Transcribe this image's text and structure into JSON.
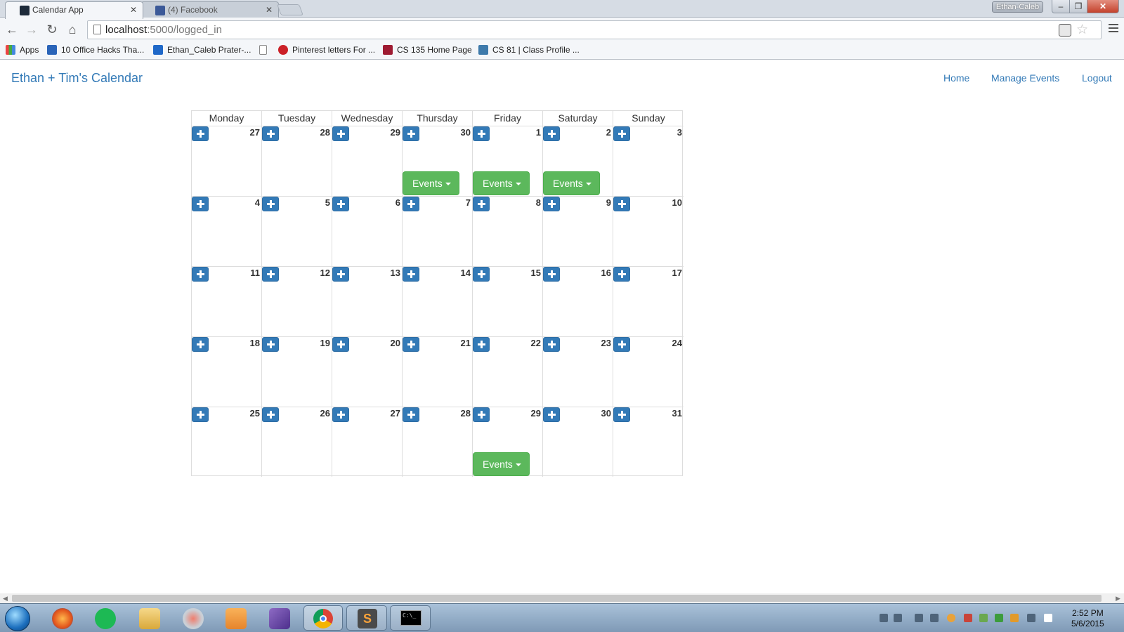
{
  "browser": {
    "tabs": [
      {
        "label": "Calendar App",
        "active": true
      },
      {
        "label": "(4) Facebook",
        "active": false
      }
    ],
    "user_badge": "Ethan-Caleb",
    "url_host": "localhost",
    "url_rest": ":5000/logged_in",
    "bookmarks": [
      {
        "label": "Apps",
        "icon": "apps-grid-icon"
      },
      {
        "label": "10 Office Hacks Tha...",
        "icon": "office-icon"
      },
      {
        "label": "Ethan_Caleb Prater-...",
        "icon": "outlook-icon"
      },
      {
        "label": "",
        "icon": "blank-page-icon"
      },
      {
        "label": "Pinterest letters For ...",
        "icon": "pinterest-icon"
      },
      {
        "label": "CS 135 Home Page",
        "icon": "cs135-icon"
      },
      {
        "label": "CS 81 | Class Profile ...",
        "icon": "piazza-icon"
      }
    ]
  },
  "app": {
    "brand": "Ethan + Tim's Calendar",
    "nav": {
      "home": "Home",
      "manage": "Manage Events",
      "logout": "Logout"
    }
  },
  "calendar": {
    "weekdays": [
      "Monday",
      "Tuesday",
      "Wednesday",
      "Thursday",
      "Friday",
      "Saturday",
      "Sunday"
    ],
    "events_label": "Events",
    "weeks": [
      [
        {
          "day": "27"
        },
        {
          "day": "28"
        },
        {
          "day": "29"
        },
        {
          "day": "30",
          "events": true
        },
        {
          "day": "1",
          "events": true
        },
        {
          "day": "2",
          "events": true
        },
        {
          "day": "3"
        }
      ],
      [
        {
          "day": "4"
        },
        {
          "day": "5"
        },
        {
          "day": "6"
        },
        {
          "day": "7"
        },
        {
          "day": "8"
        },
        {
          "day": "9"
        },
        {
          "day": "10"
        }
      ],
      [
        {
          "day": "11"
        },
        {
          "day": "12"
        },
        {
          "day": "13"
        },
        {
          "day": "14"
        },
        {
          "day": "15"
        },
        {
          "day": "16"
        },
        {
          "day": "17"
        }
      ],
      [
        {
          "day": "18"
        },
        {
          "day": "19"
        },
        {
          "day": "20"
        },
        {
          "day": "21"
        },
        {
          "day": "22"
        },
        {
          "day": "23"
        },
        {
          "day": "24"
        }
      ],
      [
        {
          "day": "25"
        },
        {
          "day": "26"
        },
        {
          "day": "27"
        },
        {
          "day": "28"
        },
        {
          "day": "29",
          "events": true
        },
        {
          "day": "30"
        },
        {
          "day": "31"
        }
      ]
    ]
  },
  "taskbar": {
    "time": "2:52 PM",
    "date": "5/6/2015",
    "apps": [
      "firefox-icon",
      "spotify-icon",
      "file-explorer-icon",
      "paint-icon",
      "media-player-icon",
      "visual-studio-icon",
      "chrome-icon",
      "sublime-text-icon",
      "command-prompt-icon"
    ]
  },
  "colors": {
    "primary": "#337ab7",
    "success": "#5cb85c",
    "border": "#dddddd"
  }
}
